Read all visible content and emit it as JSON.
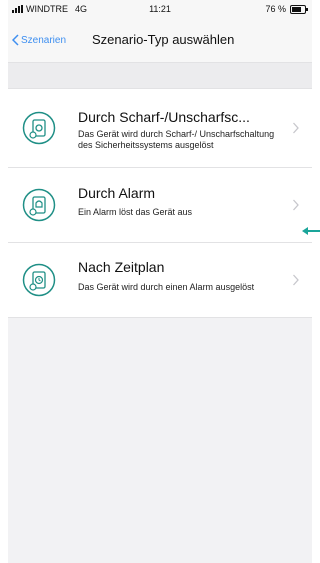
{
  "statusbar": {
    "carrier": "WINDTRE",
    "network": "4G",
    "time": "11:21",
    "battery": "76 %"
  },
  "nav": {
    "back_label": "Szenarien",
    "title": "Szenario-Typ auswählen"
  },
  "options": [
    {
      "title": "Durch Scharf-/Unscharfsc...",
      "desc": "Das Gerät wird durch Scharf-/ Unscharfschaltung des Sicherheitssystems ausgelöst",
      "icon": "arm-device-icon"
    },
    {
      "title": "Durch Alarm",
      "desc": "Ein Alarm löst das Gerät aus",
      "icon": "alarm-device-icon"
    },
    {
      "title": "Nach Zeitplan",
      "desc": "Das Gerät wird durch einen Alarm ausgelöst",
      "icon": "schedule-device-icon"
    }
  ],
  "colors": {
    "accent": "#3e8ff0",
    "icon_teal": "#1f8f86",
    "pointer": "#1aa59a"
  }
}
